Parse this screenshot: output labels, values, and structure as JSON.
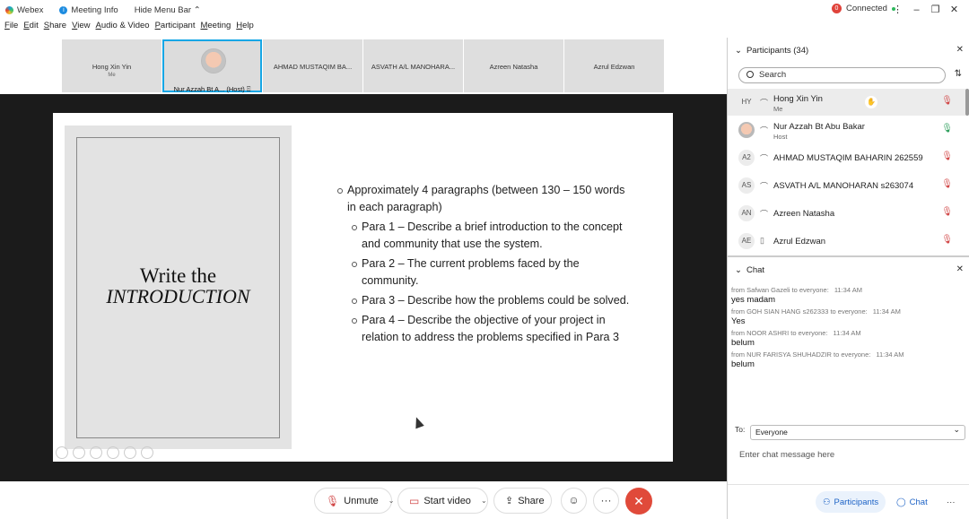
{
  "titlebar": {
    "app_name": "Webex",
    "meeting_info": "Meeting Info",
    "hide_menu": "Hide Menu Bar ⌃",
    "connection": "Connected",
    "conn_badge": "0"
  },
  "menu": [
    "File",
    "Edit",
    "Share",
    "View",
    "Audio & Video",
    "Participant",
    "Meeting",
    "Help"
  ],
  "strip": {
    "tiles": [
      {
        "name": "Hong Xin Yin",
        "sub": "Me"
      },
      {
        "name": "Nur Azzah Bt A... (Host) ⍐",
        "sub": ""
      },
      {
        "name": "AHMAD MUSTAQIM BA...",
        "sub": ""
      },
      {
        "name": "ASVATH A/L MANOHARA...",
        "sub": ""
      },
      {
        "name": "Azreen Natasha",
        "sub": ""
      },
      {
        "name": "Azrul Edzwan",
        "sub": ""
      }
    ]
  },
  "slide": {
    "title_line1": "Write the",
    "title_line2": "INTRODUCTION",
    "bullet_main": "Approximately 4 paragraphs (between 130 – 150 words in each paragraph)",
    "sub_bullets": [
      "Para 1 – Describe a brief introduction to the concept and community that use the system.",
      "Para 2 – The current problems faced by the community.",
      "Para 3 – Describe how the problems could be solved.",
      "Para 4 – Describe the objective of your project in relation to address the problems specified in Para 3"
    ]
  },
  "controls": {
    "unmute": "Unmute",
    "start_video": "Start video",
    "share": "Share"
  },
  "participants": {
    "header": "Participants (34)",
    "search_placeholder": "Search",
    "list": [
      {
        "initials": "HY",
        "name": "Hong Xin Yin",
        "role": "Me",
        "mic": "muted"
      },
      {
        "initials": "",
        "name": "Nur Azzah Bt Abu Bakar",
        "role": "Host",
        "mic": "on"
      },
      {
        "initials": "A2",
        "name": "AHMAD MUSTAQIM BAHARIN 262559",
        "role": "",
        "mic": "muted"
      },
      {
        "initials": "AS",
        "name": "ASVATH A/L MANOHARAN s263074",
        "role": "",
        "mic": "muted"
      },
      {
        "initials": "AN",
        "name": "Azreen Natasha",
        "role": "",
        "mic": "muted"
      },
      {
        "initials": "AE",
        "name": "Azrul Edzwan",
        "role": "",
        "mic": "muted"
      }
    ]
  },
  "chat": {
    "header": "Chat",
    "messages": [
      {
        "from": "from Safwan Gazeli to everyone:",
        "time": "11:34 AM",
        "text": "yes madam"
      },
      {
        "from": "from GOH SIAN HANG s262333 to everyone:",
        "time": "11:34 AM",
        "text": "Yes"
      },
      {
        "from": "from NOOR ASHRI to everyone:",
        "time": "11:34 AM",
        "text": "belum"
      },
      {
        "from": "from NUR FARISYA SHUHADZIR to everyone:",
        "time": "11:34 AM",
        "text": "belum"
      }
    ],
    "to_label": "To:",
    "to_value": "Everyone",
    "input_placeholder": "Enter chat message here"
  },
  "panel_tabs": {
    "participants": "Participants",
    "chat": "Chat"
  },
  "colors": {
    "accent": "#16a7e6",
    "leave": "#e04a3a",
    "muted": "#d14545"
  }
}
